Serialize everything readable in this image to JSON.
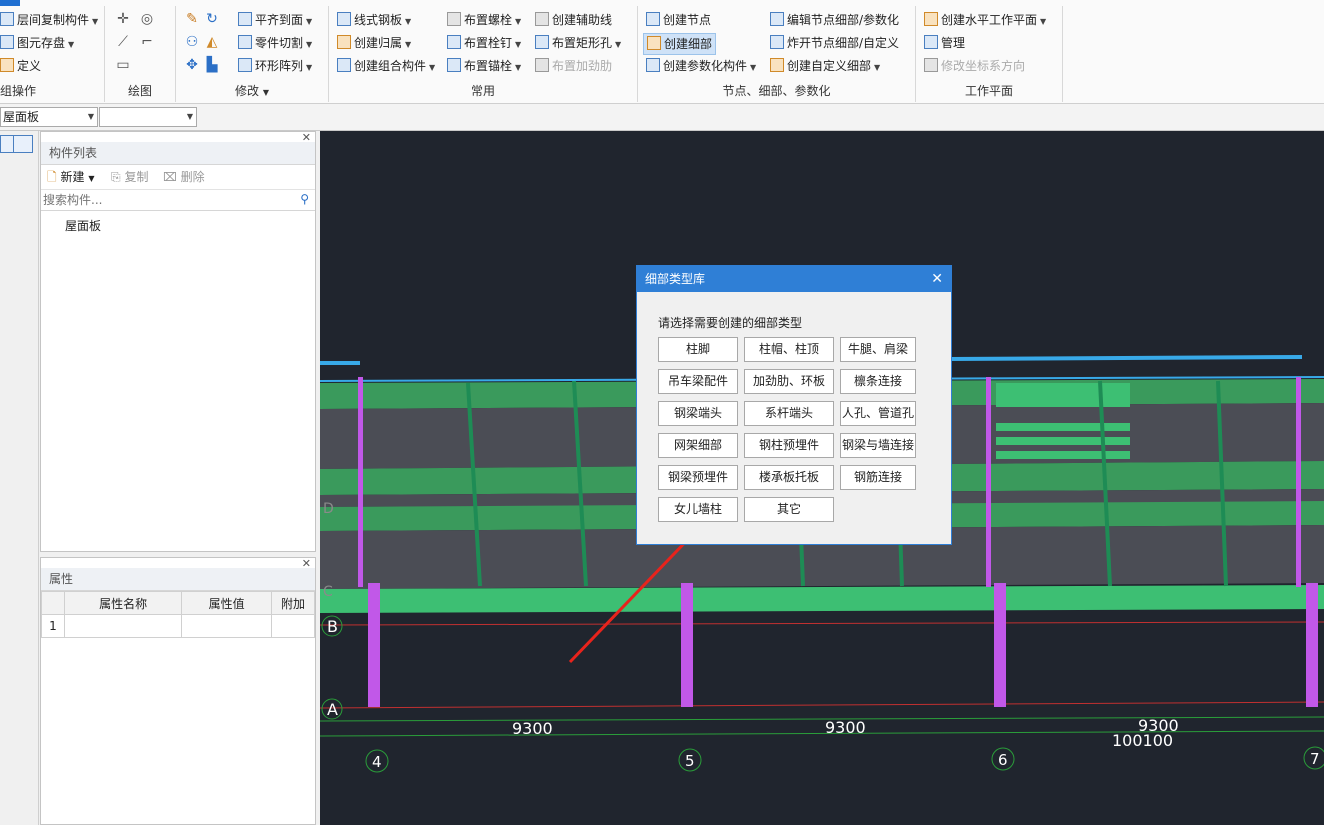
{
  "ribbon": {
    "groups": [
      {
        "title": "组操作",
        "items": [
          "层间复制构件",
          "图元存盘",
          "定义"
        ]
      },
      {
        "title": "绘图"
      },
      {
        "title": "修改",
        "items": [
          "平齐到面",
          "零件切割",
          "环形阵列"
        ]
      },
      {
        "title": "常用",
        "items": [
          "线式钢板",
          "创建归属",
          "创建组合构件",
          "布置螺栓",
          "布置栓钉",
          "布置锚栓",
          "创建辅助线",
          "布置矩形孔",
          "布置加劲肋"
        ]
      },
      {
        "title": "节点、细部、参数化",
        "items": [
          "创建节点",
          "创建细部",
          "创建参数化构件",
          "编辑节点细部/参数化",
          "炸开节点细部/自定义",
          "创建自定义细部"
        ]
      },
      {
        "title": "工作平面",
        "items": [
          "创建水平工作平面",
          "管理",
          "修改坐标系方向"
        ]
      }
    ]
  },
  "toolbar": {
    "layer_select": "屋面板",
    "second_select": ""
  },
  "component_list": {
    "title": "构件列表",
    "new_label": "新建",
    "copy_label": "复制",
    "delete_label": "删除",
    "search_placeholder": "搜索构件...",
    "items": [
      "屋面板"
    ]
  },
  "properties": {
    "title": "属性",
    "columns": [
      "属性名称",
      "属性值",
      "附加"
    ],
    "rows": [
      {
        "index": "1",
        "name": "",
        "value": "",
        "extra": ""
      }
    ]
  },
  "canvas": {
    "axis_rows": [
      "A",
      "B",
      "C",
      "D"
    ],
    "axis_cols": [
      "4",
      "5",
      "6",
      "7"
    ],
    "dims": [
      "9300",
      "9300",
      "9300",
      "100100"
    ]
  },
  "dialog": {
    "title": "细部类型库",
    "prompt": "请选择需要创建的细部类型",
    "types": [
      "柱脚",
      "柱帽、柱顶",
      "牛腿、肩梁",
      "吊车梁配件",
      "加劲肋、环板",
      "檩条连接",
      "钢梁端头",
      "系杆端头",
      "人孔、管道孔",
      "网架细部",
      "钢柱预埋件",
      "钢梁与墙连接",
      "钢梁预埋件",
      "楼承板托板",
      "钢筋连接",
      "女儿墙柱",
      "其它"
    ]
  },
  "colors": {
    "accent": "#2f7fd6",
    "canvas_bg": "#20252e",
    "beam": "#3dbf73",
    "column": "#c158e8",
    "arrow": "#e8231c"
  }
}
